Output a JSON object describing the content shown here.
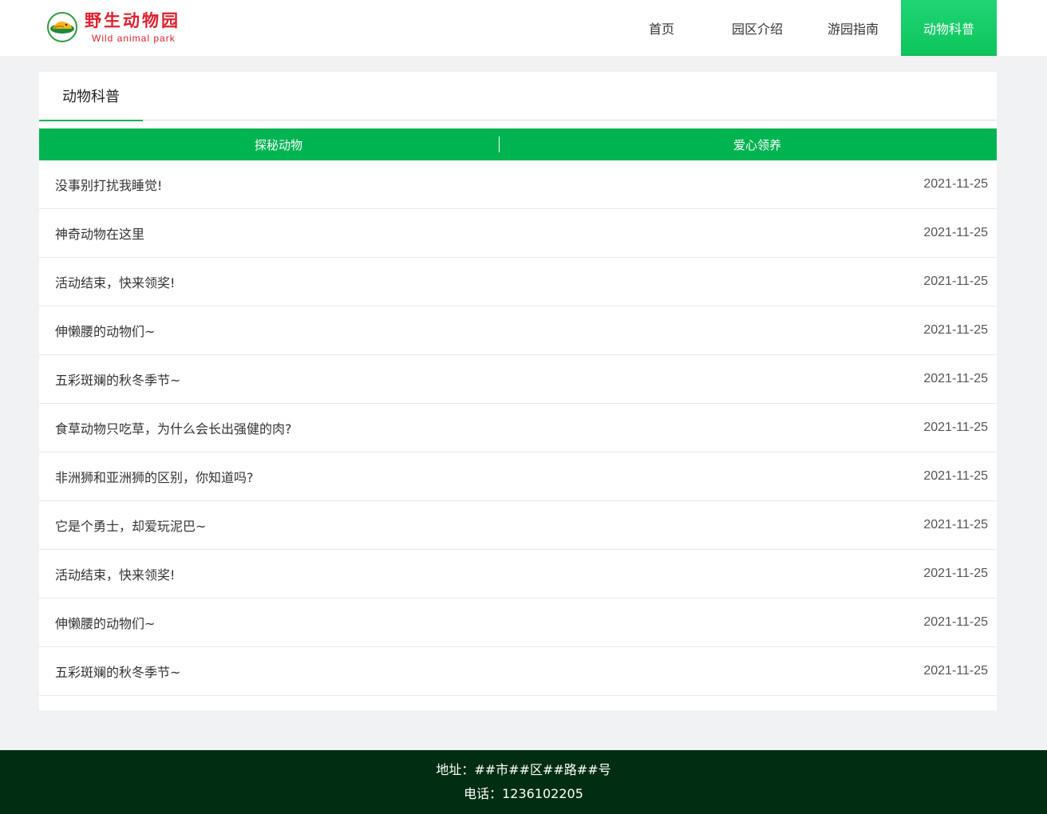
{
  "brand": {
    "name_cn": "野生动物园",
    "name_en": "Wild animal park",
    "logo_icon": "elephant-logo-icon",
    "color": "#e0202e"
  },
  "nav": {
    "items": [
      {
        "label": "首页",
        "active": false
      },
      {
        "label": "园区介绍",
        "active": false
      },
      {
        "label": "游园指南",
        "active": false
      },
      {
        "label": "动物科普",
        "active": true
      }
    ],
    "active_color": "#13c862"
  },
  "section": {
    "title": "动物科普",
    "accent": "#00b451"
  },
  "subtabs": [
    {
      "label": "探秘动物"
    },
    {
      "label": "爱心领养"
    }
  ],
  "articles": [
    {
      "title": "没事别打扰我睡觉!",
      "date": "2021-11-25"
    },
    {
      "title": "神奇动物在这里",
      "date": "2021-11-25"
    },
    {
      "title": "活动结束，快来领奖!",
      "date": "2021-11-25"
    },
    {
      "title": "伸懒腰的动物们~",
      "date": "2021-11-25"
    },
    {
      "title": "五彩斑斓的秋冬季节~",
      "date": "2021-11-25"
    },
    {
      "title": "食草动物只吃草，为什么会长出强健的肉?",
      "date": "2021-11-25"
    },
    {
      "title": "非洲狮和亚洲狮的区别，你知道吗?",
      "date": "2021-11-25"
    },
    {
      "title": "它是个勇士，却爱玩泥巴~",
      "date": "2021-11-25"
    },
    {
      "title": "活动结束，快来领奖!",
      "date": "2021-11-25"
    },
    {
      "title": "伸懒腰的动物们~",
      "date": "2021-11-25"
    },
    {
      "title": "五彩斑斓的秋冬季节~",
      "date": "2021-11-25"
    }
  ],
  "footer": {
    "address": "地址：##市##区##路##号",
    "phone": "电话：1236102205",
    "background": "#012e13"
  }
}
